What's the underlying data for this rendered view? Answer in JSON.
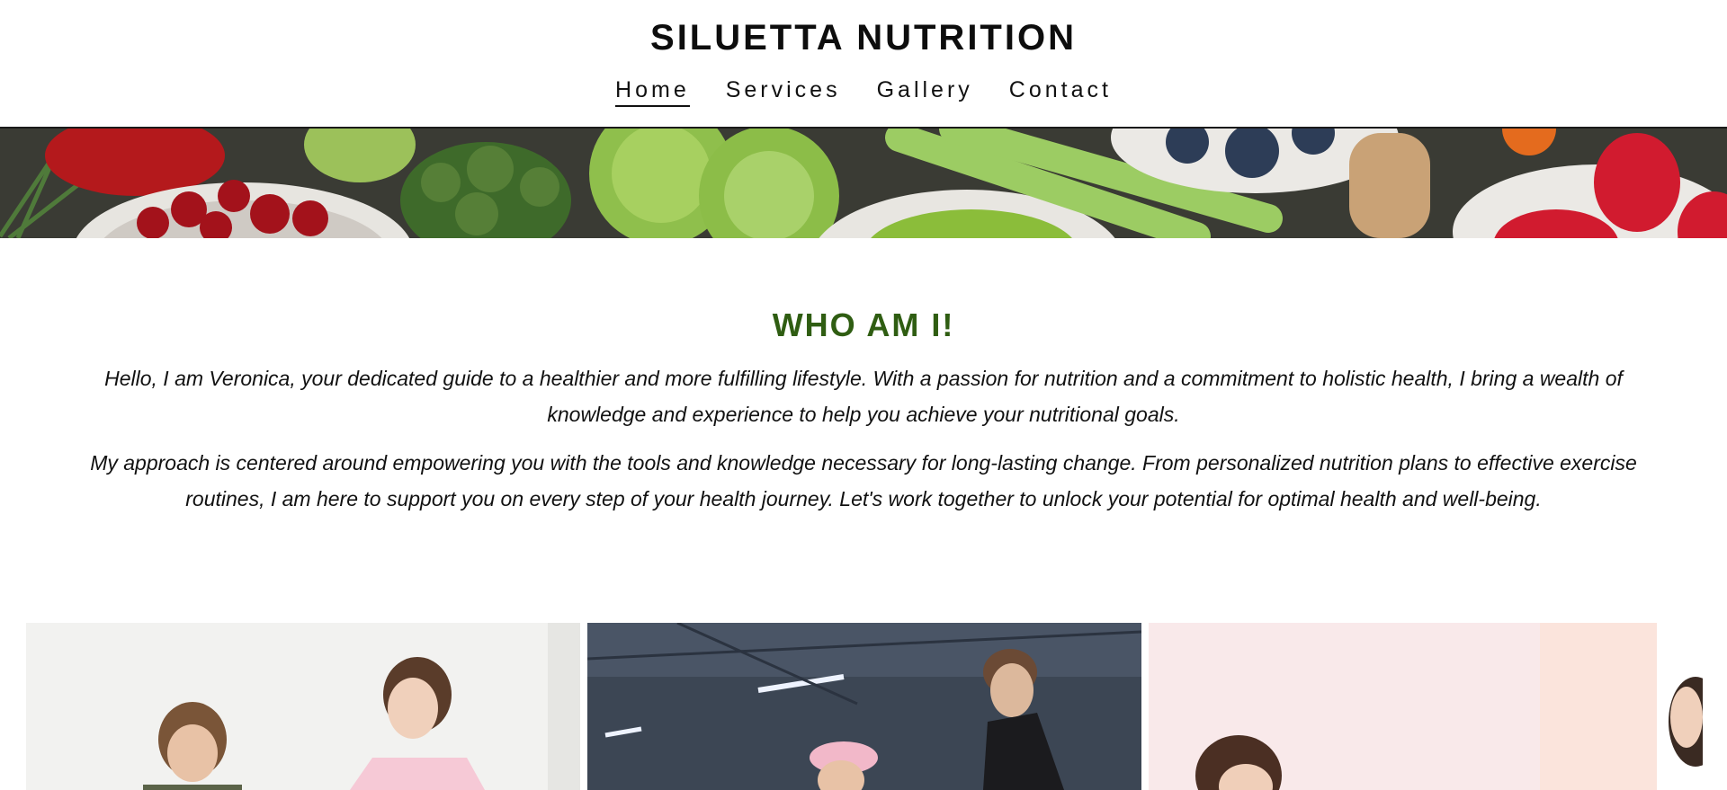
{
  "site": {
    "title": "SILUETTA NUTRITION"
  },
  "nav": {
    "items": [
      {
        "label": "Home",
        "active": true
      },
      {
        "label": "Services",
        "active": false
      },
      {
        "label": "Gallery",
        "active": false
      },
      {
        "label": "Contact",
        "active": false
      }
    ]
  },
  "intro": {
    "heading": "WHO AM I!",
    "paragraph1": "Hello, I am Veronica, your dedicated guide to a healthier and more fulfilling lifestyle. With a passion for nutrition and a commitment to holistic health, I bring a wealth of knowledge and experience to help you achieve your nutritional goals.",
    "paragraph2": "My approach is centered around empowering you with the tools and knowledge necessary for long-lasting change. From personalized nutrition plans to effective exercise routines, I am here to support you on every step of your health journey. Let's work together to unlock your potential for optimal health and well-being."
  },
  "colors": {
    "heading_green": "#2f5d12",
    "nav_text": "#111111"
  }
}
